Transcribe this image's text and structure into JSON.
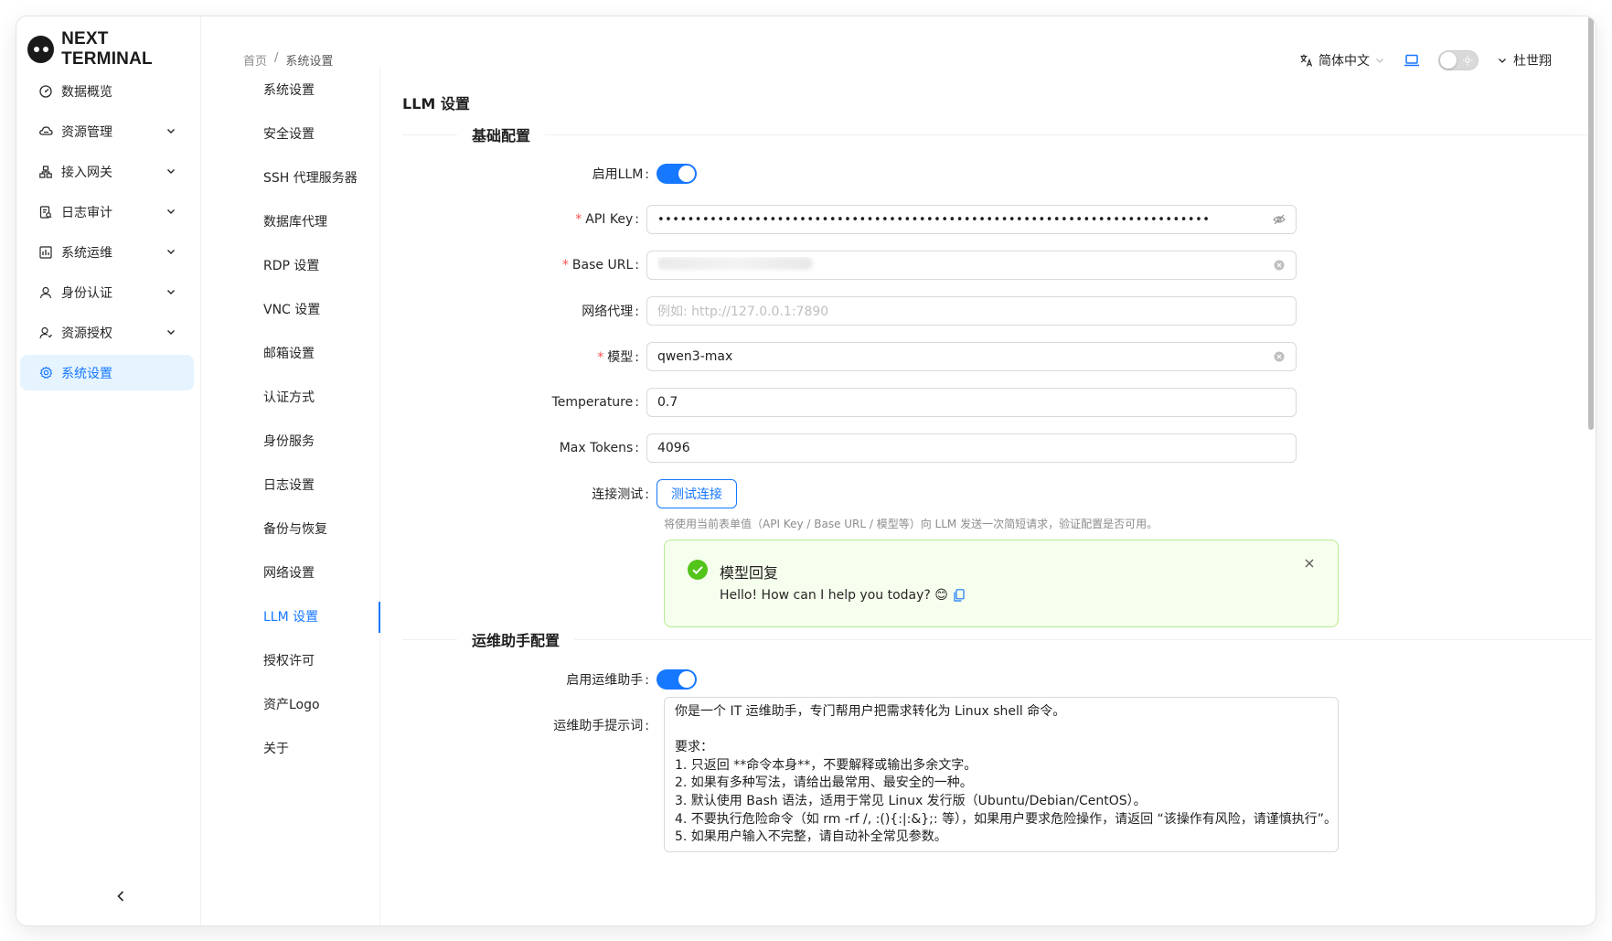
{
  "brand": {
    "name": "NEXT TERMINAL"
  },
  "sidebar": {
    "items": [
      {
        "label": "数据概览",
        "icon": "dashboard-icon",
        "expandable": false,
        "active": false
      },
      {
        "label": "资源管理",
        "icon": "cloud-icon",
        "expandable": true,
        "active": false
      },
      {
        "label": "接入网关",
        "icon": "gateway-icon",
        "expandable": true,
        "active": false
      },
      {
        "label": "日志审计",
        "icon": "audit-icon",
        "expandable": true,
        "active": false
      },
      {
        "label": "系统运维",
        "icon": "ops-icon",
        "expandable": true,
        "active": false
      },
      {
        "label": "身份认证",
        "icon": "user-icon",
        "expandable": true,
        "active": false
      },
      {
        "label": "资源授权",
        "icon": "user-auth-icon",
        "expandable": true,
        "active": false
      },
      {
        "label": "系统设置",
        "icon": "gear-icon",
        "expandable": false,
        "active": true
      }
    ]
  },
  "breadcrumb": {
    "home": "首页",
    "sep": "/",
    "current": "系统设置"
  },
  "topbar": {
    "language": "简体中文",
    "user": "杜世翔"
  },
  "submenu": {
    "items": [
      "系统设置",
      "安全设置",
      "SSH 代理服务器",
      "数据库代理",
      "RDP 设置",
      "VNC 设置",
      "邮箱设置",
      "认证方式",
      "身份服务",
      "日志设置",
      "备份与恢复",
      "网络设置",
      "LLM 设置",
      "授权许可",
      "资产Logo",
      "关于"
    ],
    "active_index": 12
  },
  "page": {
    "title": "LLM 设置"
  },
  "basic": {
    "section_title": "基础配置",
    "enable_llm": {
      "label": "启用LLM",
      "value": true
    },
    "api_key": {
      "label": "API Key",
      "required": true,
      "masked": "••••••••••••••••••••••••••••••••••••••••••••••••••••••••••••••••••••••••••"
    },
    "base_url": {
      "label": "Base URL",
      "required": true
    },
    "proxy": {
      "label": "网络代理",
      "required": false,
      "placeholder": "例如: http://127.0.0.1:7890"
    },
    "model": {
      "label": "模型",
      "required": true,
      "value": "qwen3-max"
    },
    "temperature": {
      "label": "Temperature",
      "value": "0.7"
    },
    "max_tokens": {
      "label": "Max Tokens",
      "value": "4096"
    },
    "test": {
      "label": "连接测试",
      "button": "测试连接",
      "help": "将使用当前表单值（API Key / Base URL / 模型等）向 LLM 发送一次简短请求，验证配置是否可用。"
    },
    "result": {
      "title": "模型回复",
      "message": "Hello! How can I help you today? 😊"
    }
  },
  "assistant": {
    "section_title": "运维助手配置",
    "enable": {
      "label": "启用运维助手",
      "value": true
    },
    "prompt": {
      "label": "运维助手提示词",
      "lines": [
        "你是一个 IT 运维助手，专门帮用户把需求转化为 Linux shell 命令。",
        "",
        "要求：",
        "1. 只返回 **命令本身**，不要解释或输出多余文字。",
        "2. 如果有多种写法，请给出最常用、最安全的一种。",
        "3. 默认使用 Bash 语法，适用于常见 Linux 发行版（Ubuntu/Debian/CentOS）。",
        "4. 不要执行危险命令（如 rm -rf /, :(){:|:&};: 等），如果用户要求危险操作，请返回 “该操作有风险，请谨慎执行”。",
        "5. 如果用户输入不完整，请自动补全常见参数。"
      ]
    }
  },
  "colors": {
    "accent": "#1677ff",
    "success": "#52c41a",
    "success_bg": "#f6ffed",
    "required": "#ff4d4f"
  }
}
